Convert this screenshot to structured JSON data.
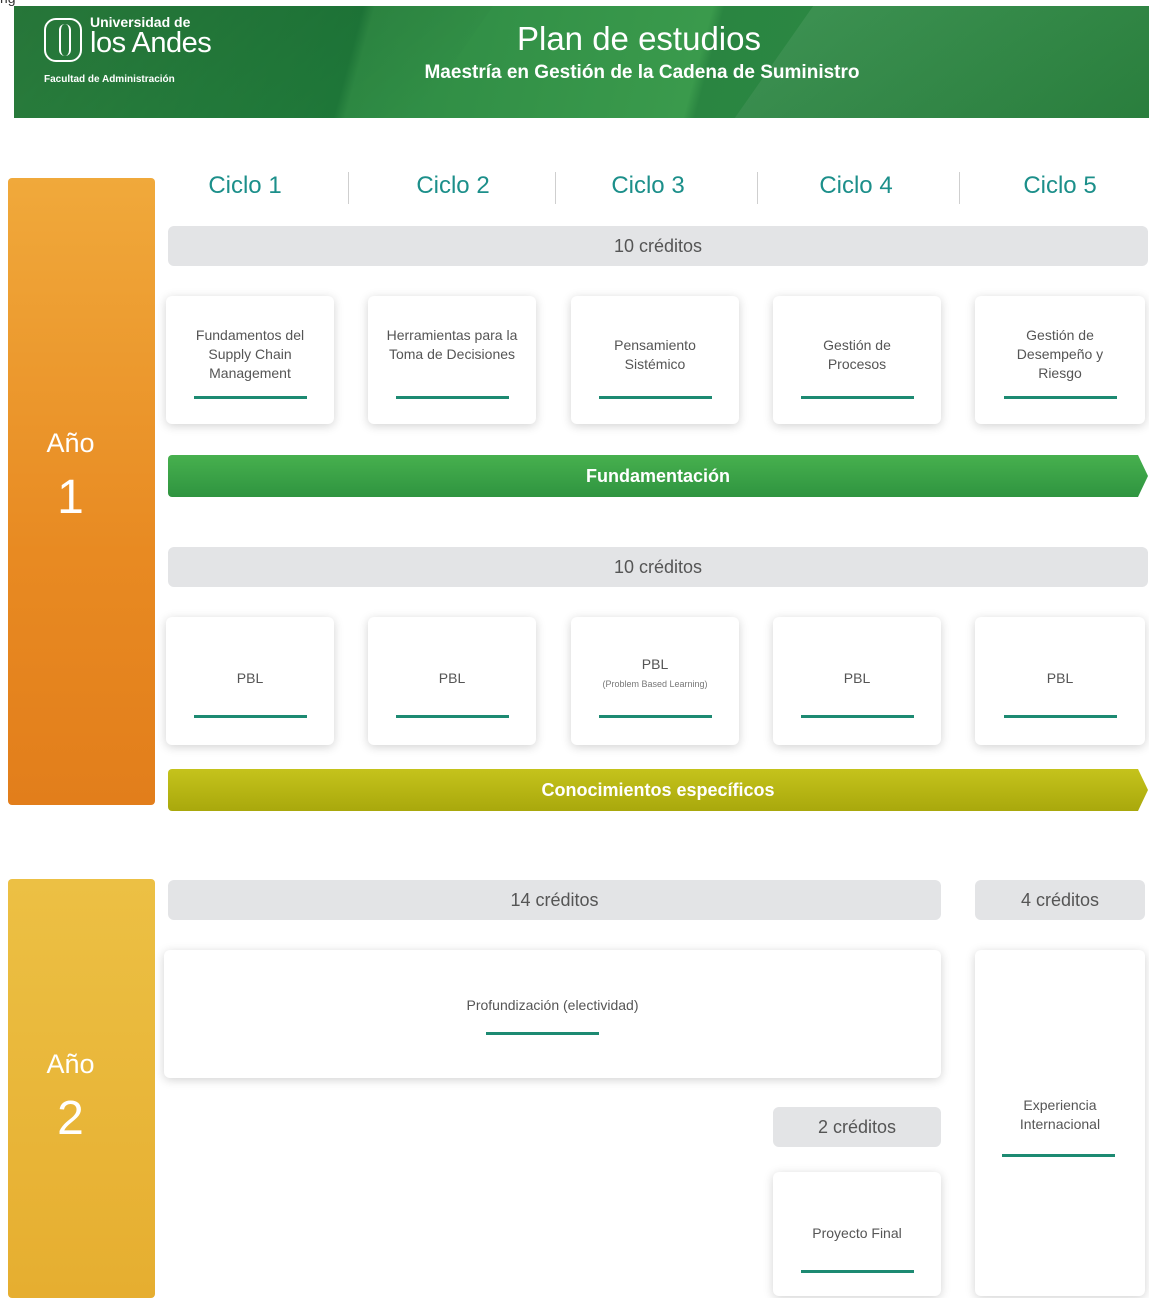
{
  "top_cut_text": "rig",
  "header": {
    "logo_line1": "Universidad de",
    "logo_line2": "los Andes",
    "logo_line3": "Facultad de Administración",
    "title": "Plan de estudios",
    "subtitle": "Maestría en Gestión de la Cadena de Suministro"
  },
  "cycles": [
    "Ciclo 1",
    "Ciclo 2",
    "Ciclo 3",
    "Ciclo 4",
    "Ciclo 5"
  ],
  "year1": {
    "label": "Año",
    "number": "1",
    "credits_a": "10 créditos",
    "courses": [
      "Fundamentos del Supply Chain Management",
      "Herramientas para la Toma de Decisiones",
      "Pensamiento Sistémico",
      "Gestión de Procesos",
      "Gestión de Desempeño y Riesgo"
    ],
    "stage_a": "Fundamentación",
    "credits_b": "10 créditos",
    "pbl": [
      "PBL",
      "PBL",
      "PBL",
      "PBL",
      "PBL"
    ],
    "pbl_note": "(Problem Based Learning)",
    "stage_b": "Conocimientos específicos"
  },
  "year2": {
    "label": "Año",
    "number": "2",
    "credits_main": "14 créditos",
    "credits_side": "4 créditos",
    "profundizacion": "Profundización (electividad)",
    "experiencia": "Experiencia Internacional",
    "credits_final": "2 créditos",
    "proyecto": "Proyecto Final"
  },
  "colors": {
    "banner_green": "#2f8f45",
    "year1_orange": "#e88a22",
    "year2_yellow": "#e6ae30",
    "cycle_teal": "#1c8f8a",
    "stage_green": "#3aa247",
    "stage_olive": "#b8b614",
    "card_underline": "#1d8a72"
  }
}
